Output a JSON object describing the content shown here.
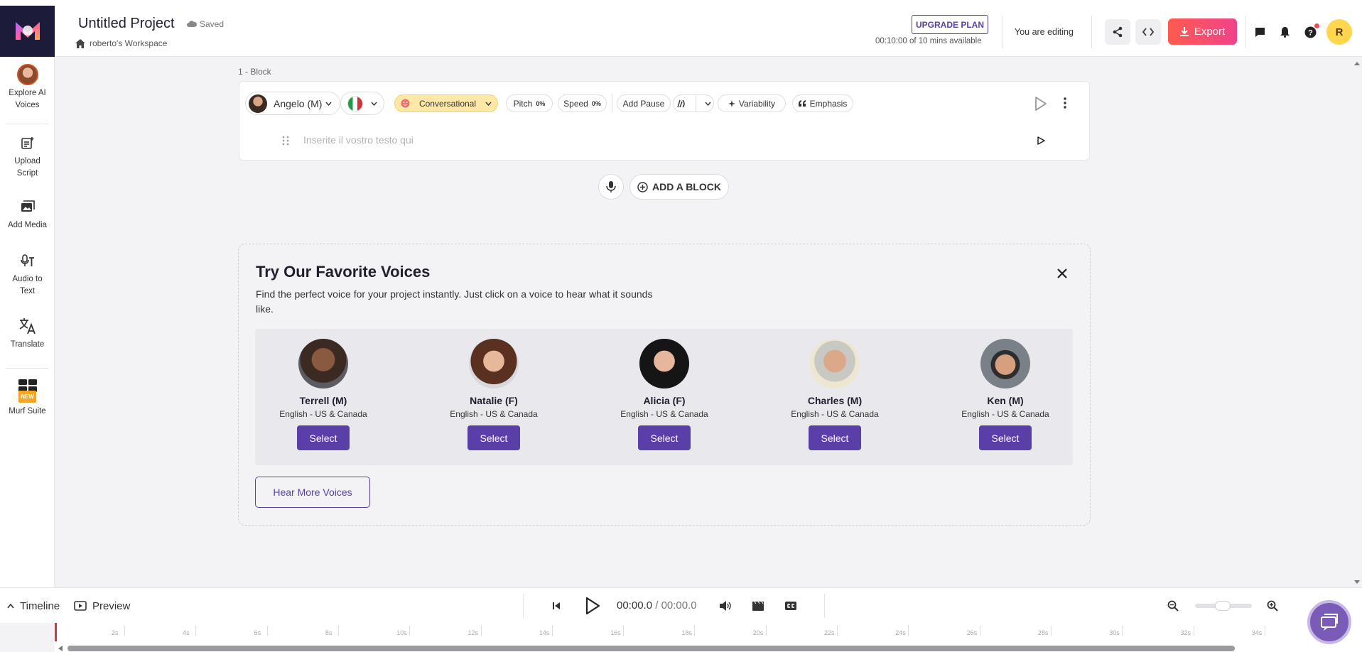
{
  "header": {
    "project_title": "Untitled Project",
    "saved_status": "Saved",
    "workspace": "roberto's Workspace",
    "upgrade_label": "UPGRADE PLAN",
    "mins_available": "00:10:00 of 10 mins available",
    "editing_label": "You are editing",
    "export_label": "Export",
    "avatar_initial": "R",
    "accent_color": "#5a3fa8",
    "export_gradient": [
      "#ff5a4e",
      "#f0438a"
    ]
  },
  "sidebar": {
    "items": [
      {
        "label": "Explore AI Voices",
        "icon": "explore-voices-avatar"
      },
      {
        "label": "Upload Script",
        "icon": "upload-script-icon"
      },
      {
        "label": "Add Media",
        "icon": "media-icon"
      },
      {
        "label": "Audio to Text",
        "icon": "audio-to-text-icon"
      },
      {
        "label": "Translate",
        "icon": "translate-icon"
      },
      {
        "label": "Murf Suite",
        "icon": "suite-icon",
        "badge": "NEW"
      }
    ]
  },
  "block": {
    "label": "1 -  Block",
    "voice_name": "Angelo (M)",
    "style": "Conversational",
    "pitch_label": "Pitch",
    "pitch_value": "0%",
    "speed_label": "Speed",
    "speed_value": "0%",
    "add_pause": "Add Pause",
    "variability": "Variability",
    "emphasis": "Emphasis",
    "placeholder": "Inserite il vostro testo qui"
  },
  "add_block_label": "ADD A BLOCK",
  "favorites": {
    "title": "Try Our Favorite Voices",
    "subtitle": "Find the perfect voice for your project instantly. Just click on a voice to hear what it sounds like.",
    "select_label": "Select",
    "hear_more": "Hear More Voices",
    "voices": [
      {
        "name": "Terrell (M)",
        "language": "English - US & Canada"
      },
      {
        "name": "Natalie (F)",
        "language": "English - US & Canada"
      },
      {
        "name": "Alicia (F)",
        "language": "English - US & Canada"
      },
      {
        "name": "Charles (M)",
        "language": "English - US & Canada"
      },
      {
        "name": "Ken (M)",
        "language": "English - US & Canada"
      }
    ]
  },
  "player": {
    "timeline_label": "Timeline",
    "preview_label": "Preview",
    "current_time": "00:00.0",
    "separator": " / ",
    "duration": "00:00.0"
  },
  "timeline": {
    "ticks": [
      "2s",
      "4s",
      "6s",
      "8s",
      "10s",
      "12s",
      "14s",
      "16s",
      "18s",
      "20s",
      "22s",
      "24s",
      "26s",
      "28s",
      "30s",
      "32s",
      "34s"
    ]
  }
}
